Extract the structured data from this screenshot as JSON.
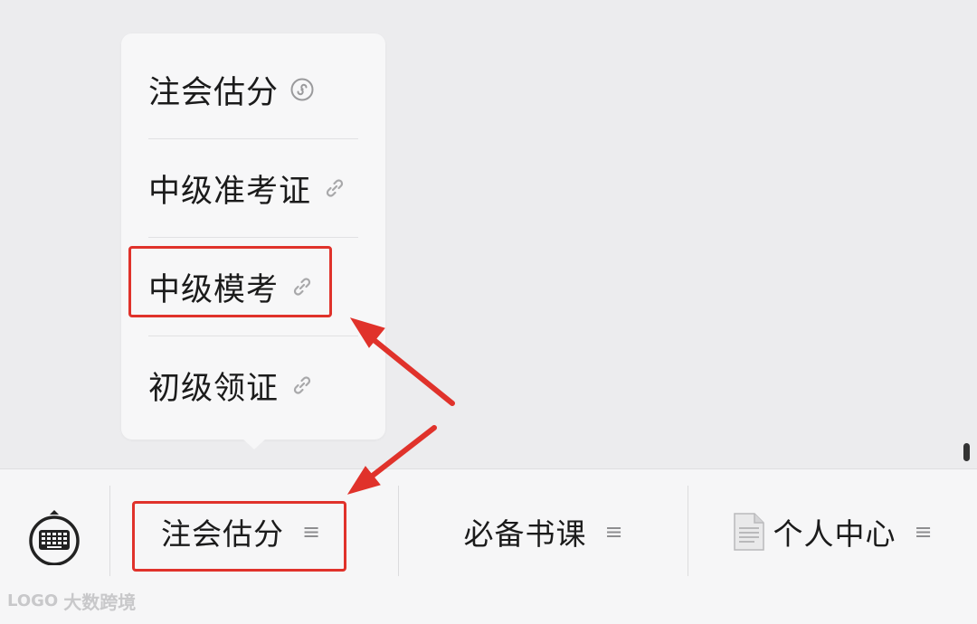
{
  "popup_menu": {
    "items": [
      {
        "label": "注会估分",
        "icon": "mini-program-icon"
      },
      {
        "label": "中级准考证",
        "icon": "link-icon"
      },
      {
        "label": "中级模考",
        "icon": "link-icon",
        "highlighted": true
      },
      {
        "label": "初级领证",
        "icon": "link-icon"
      }
    ]
  },
  "bottom_bar": {
    "keyboard_icon": "keyboard-icon",
    "tabs": [
      {
        "label": "注会估分",
        "icon": "menu-lines-icon",
        "highlighted": true
      },
      {
        "label": "必备书课",
        "icon": "menu-lines-icon"
      },
      {
        "label": "个人中心",
        "prefix_icon": "document-icon",
        "icon": "menu-lines-icon"
      }
    ],
    "menu_glyph": "≡"
  },
  "watermark": {
    "logo": "LOGO",
    "text": "大数跨境"
  },
  "colors": {
    "highlight": "#e0322b",
    "background": "#ececee",
    "popup": "#f7f7f8",
    "bar": "#f6f6f7"
  }
}
